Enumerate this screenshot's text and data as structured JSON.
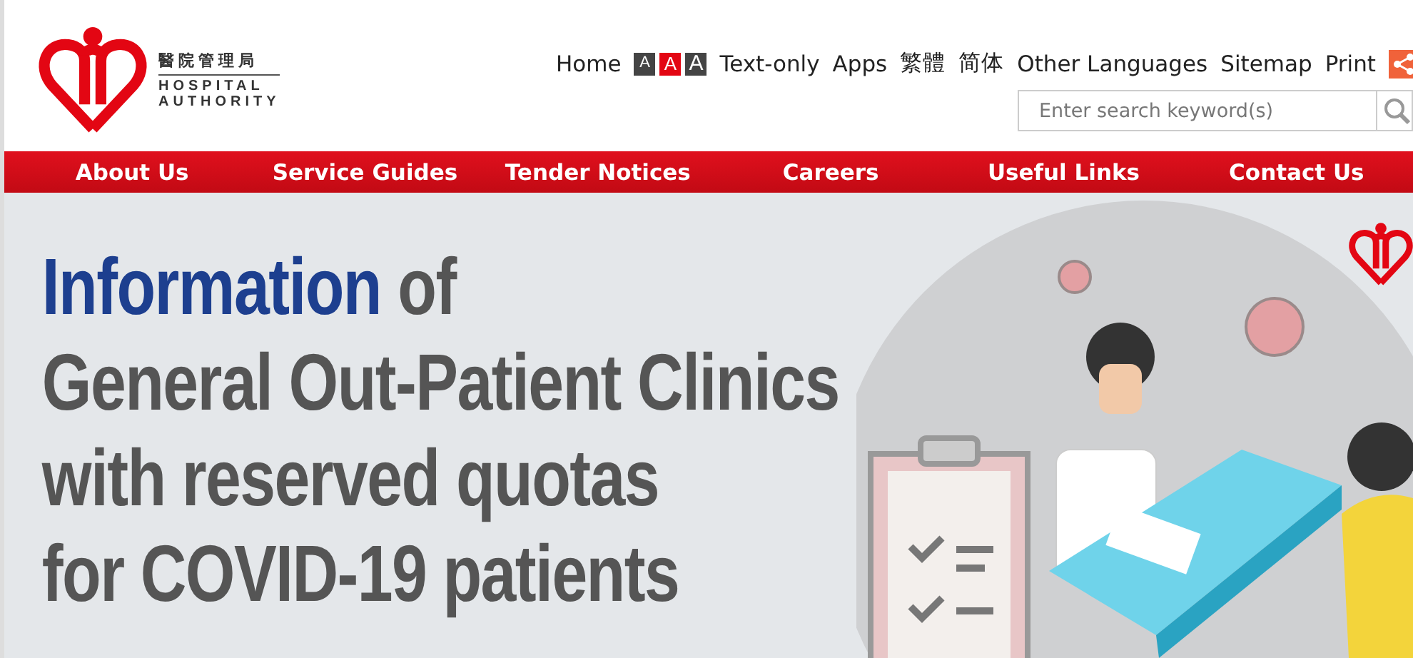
{
  "logo": {
    "chinese": "醫院管理局",
    "line_1": "HOSPITAL",
    "line_2": "AUTHORITY"
  },
  "top_links": {
    "home": "Home",
    "font_sizes": [
      {
        "label": "A",
        "selected": false
      },
      {
        "label": "A",
        "selected": true
      },
      {
        "label": "A",
        "selected": false
      }
    ],
    "links": [
      "Text-only",
      "Apps",
      "繁體",
      "简体",
      "Other Languages",
      "Sitemap",
      "Print"
    ]
  },
  "search": {
    "placeholder": "Enter search keyword(s)"
  },
  "nav": [
    "About Us",
    "Service Guides",
    "Tender Notices",
    "Careers",
    "Useful Links",
    "Contact Us"
  ],
  "banner": {
    "highlight": "Information",
    "rest": "of",
    "lines": [
      "General Out-Patient Clinics",
      "with reserved quotas",
      "for COVID-19 patients"
    ]
  }
}
